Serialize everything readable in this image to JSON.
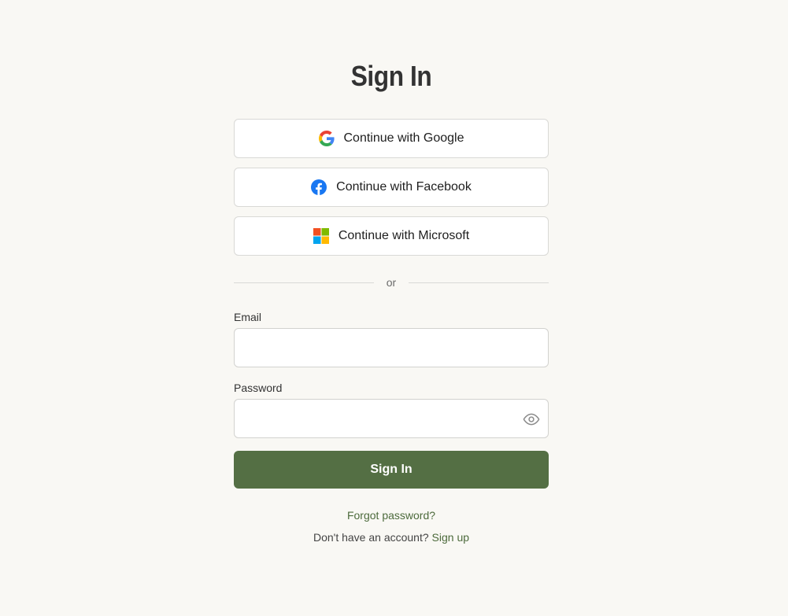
{
  "page": {
    "title": "Sign In"
  },
  "social": {
    "google": {
      "label": "Continue with Google",
      "icon": "google-icon"
    },
    "facebook": {
      "label": "Continue with Facebook",
      "icon": "facebook-icon"
    },
    "microsoft": {
      "label": "Continue with Microsoft",
      "icon": "microsoft-icon"
    }
  },
  "divider": {
    "text": "or"
  },
  "form": {
    "email_label": "Email",
    "email_value": "",
    "password_label": "Password",
    "password_value": "",
    "password_toggle_icon": "eye-icon",
    "submit_label": "Sign In"
  },
  "links": {
    "forgot": "Forgot password?",
    "no_account": "Don't have an account?",
    "signup": "Sign up"
  },
  "colors": {
    "background": "#f9f8f4",
    "primary": "#546f44",
    "link": "#4c6a3b"
  }
}
